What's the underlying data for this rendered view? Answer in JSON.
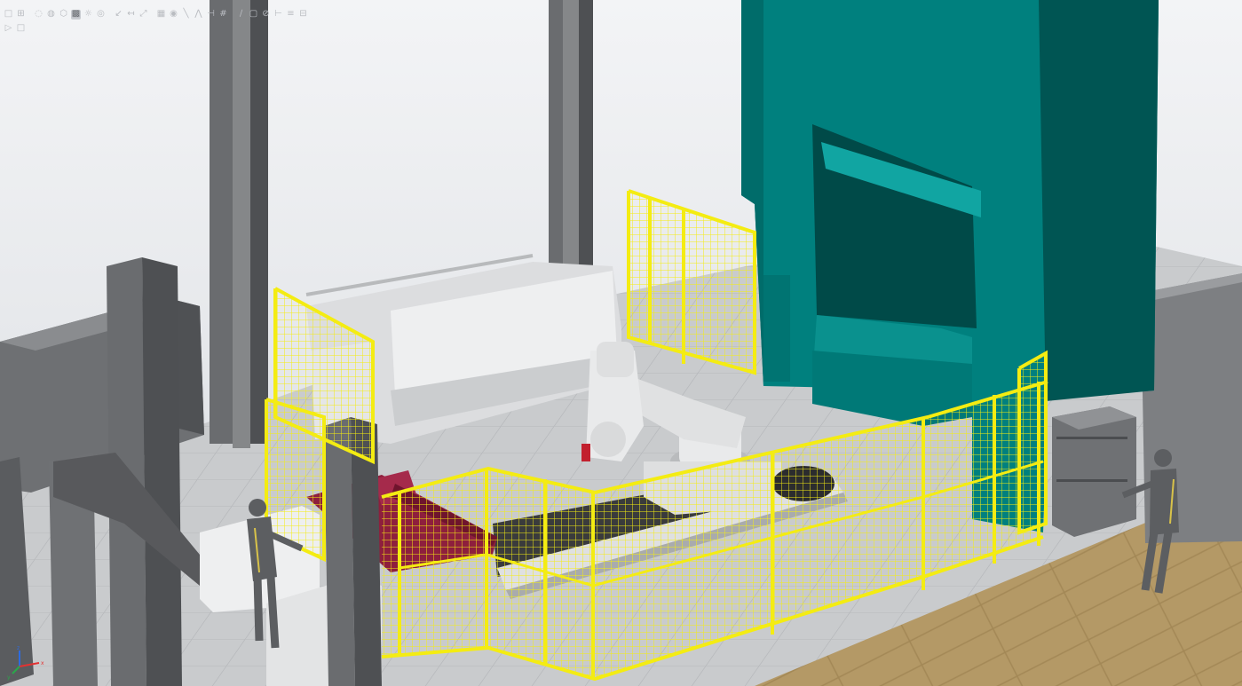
{
  "toolbar": {
    "row1": [
      {
        "name": "view-all-icon",
        "glyph": "□"
      },
      {
        "name": "view-selected-icon",
        "glyph": "⊞"
      },
      {
        "name": "sep"
      },
      {
        "name": "wireframe-icon",
        "glyph": "◌"
      },
      {
        "name": "shaded-icon",
        "glyph": "◍"
      },
      {
        "name": "shaded-edges-icon",
        "glyph": "⬡"
      },
      {
        "name": "render-mode-icon",
        "glyph": "▩",
        "active": true
      },
      {
        "name": "lighting-icon",
        "glyph": "☼"
      },
      {
        "name": "material-icon",
        "glyph": "◎"
      },
      {
        "name": "sep"
      },
      {
        "name": "measure-point-icon",
        "glyph": "↙"
      },
      {
        "name": "measure-distance-icon",
        "glyph": "↤"
      },
      {
        "name": "measure-angle-icon",
        "glyph": "⤢"
      },
      {
        "name": "sep"
      },
      {
        "name": "grid-icon",
        "glyph": "▦"
      },
      {
        "name": "snap-center-icon",
        "glyph": "◉"
      },
      {
        "name": "snap-edge-icon",
        "glyph": "╲"
      },
      {
        "name": "snap-midpoint-icon",
        "glyph": "⋀"
      },
      {
        "name": "snap-end-icon",
        "glyph": "⊣"
      },
      {
        "name": "snap-grid-icon",
        "glyph": "#"
      },
      {
        "name": "sep"
      },
      {
        "name": "line-tool-icon",
        "glyph": "∕"
      },
      {
        "name": "frame-tool-icon",
        "glyph": "▢"
      },
      {
        "name": "no-entry-icon",
        "glyph": "⊘"
      },
      {
        "name": "target-icon",
        "glyph": "⊢"
      },
      {
        "name": "pin-icon",
        "glyph": "≡"
      },
      {
        "name": "bolt-icon",
        "glyph": "⊟"
      }
    ],
    "row2": [
      {
        "name": "play-icon",
        "glyph": "▷"
      },
      {
        "name": "stop-icon",
        "glyph": "□"
      }
    ]
  },
  "axis": {
    "x_label": "x",
    "y_label": "y",
    "z_label": "z"
  },
  "colors": {
    "background_top": "#f0f1f3",
    "background_bottom": "#dcdfe3",
    "floor": "#c9cbcd",
    "floor_tile_line": "#b4b6b9",
    "wood_floor": "#b49966",
    "column": "#6a6c6f",
    "column_dark": "#4e5053",
    "press_teal": "#00807e",
    "press_teal_dark": "#005553",
    "press_teal_light": "#11a5a2",
    "fence_yellow": "#f4ec12",
    "robot_white": "#e9eaeb",
    "robot_shade": "#b9bbbd",
    "cabinet_gray": "#7d7f82",
    "cabinet_dark": "#5b5d60",
    "part_red": "#8e1f3d",
    "human_gray": "#5c5e61",
    "human_accent": "#d8c24a",
    "axis_x": "#e33232",
    "axis_y": "#2aa84a",
    "axis_z": "#2d6be0"
  }
}
